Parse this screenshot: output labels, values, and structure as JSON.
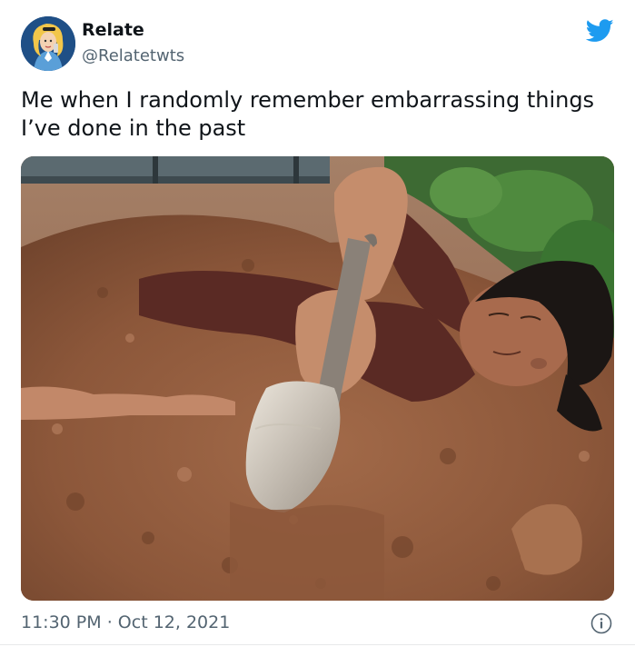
{
  "tweet": {
    "author_name": "Relate",
    "author_handle": "@Relatetwts",
    "text": "Me when I randomly remember embarrassing things I’ve done in the past",
    "time": "11:30 PM",
    "separator": "·",
    "date": "Oct 12, 2021"
  },
  "icons": {
    "brand": "twitter-bird-icon",
    "info": "info-icon"
  },
  "colors": {
    "twitter_blue": "#1d9bf0",
    "secondary_text": "#536471",
    "primary_text": "#0f1419"
  }
}
